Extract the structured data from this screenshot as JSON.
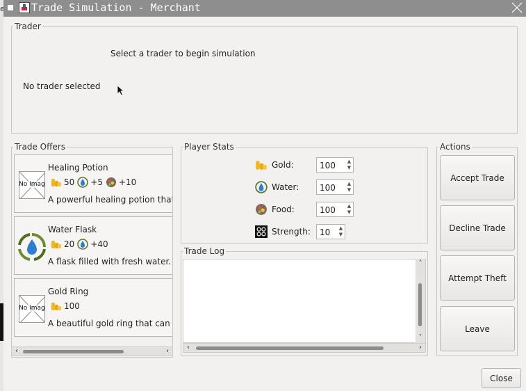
{
  "window": {
    "title": "Trade Simulation - Merchant",
    "background_app_char": "e"
  },
  "trader": {
    "group_label": "Trader",
    "hint": "Select a trader to begin simulation",
    "status": "No trader selected"
  },
  "offers": {
    "group_label": "Trade Offers",
    "items": [
      {
        "name": "Healing Potion",
        "image": "no-image",
        "no_image_text": "No Image",
        "costs": [
          {
            "icon": "gold-icon",
            "value": "50"
          },
          {
            "icon": "water-icon",
            "value": "+5"
          },
          {
            "icon": "food-icon",
            "value": "+10"
          }
        ],
        "description": "A powerful healing potion that"
      },
      {
        "name": "Water Flask",
        "image": "water-flask-icon",
        "costs": [
          {
            "icon": "gold-icon",
            "value": "20"
          },
          {
            "icon": "water-icon",
            "value": "+40"
          }
        ],
        "description": "A flask filled with fresh water."
      },
      {
        "name": "Gold Ring",
        "image": "no-image",
        "no_image_text": "No Image",
        "costs": [
          {
            "icon": "gold-icon",
            "value": "100"
          }
        ],
        "description": "A beautiful gold ring that can b"
      }
    ]
  },
  "stats": {
    "group_label": "Player Stats",
    "items": [
      {
        "icon": "gold-icon",
        "label": "Gold:",
        "value": "100"
      },
      {
        "icon": "water-icon",
        "label": "Water:",
        "value": "100"
      },
      {
        "icon": "food-icon",
        "label": "Food:",
        "value": "100"
      },
      {
        "icon": "strength-icon",
        "label": "Strength:",
        "value": "10"
      }
    ]
  },
  "log": {
    "group_label": "Trade Log",
    "entries": []
  },
  "actions": {
    "group_label": "Actions",
    "accept": "Accept Trade",
    "decline": "Decline Trade",
    "theft": "Attempt Theft",
    "leave": "Leave"
  },
  "footer": {
    "close": "Close"
  },
  "colors": {
    "titlebar": "#8e8e8e",
    "window_bg": "#f2f1f0",
    "gold": "#f2b51b",
    "water": "#2a7fd4",
    "food": "#d9534f"
  }
}
